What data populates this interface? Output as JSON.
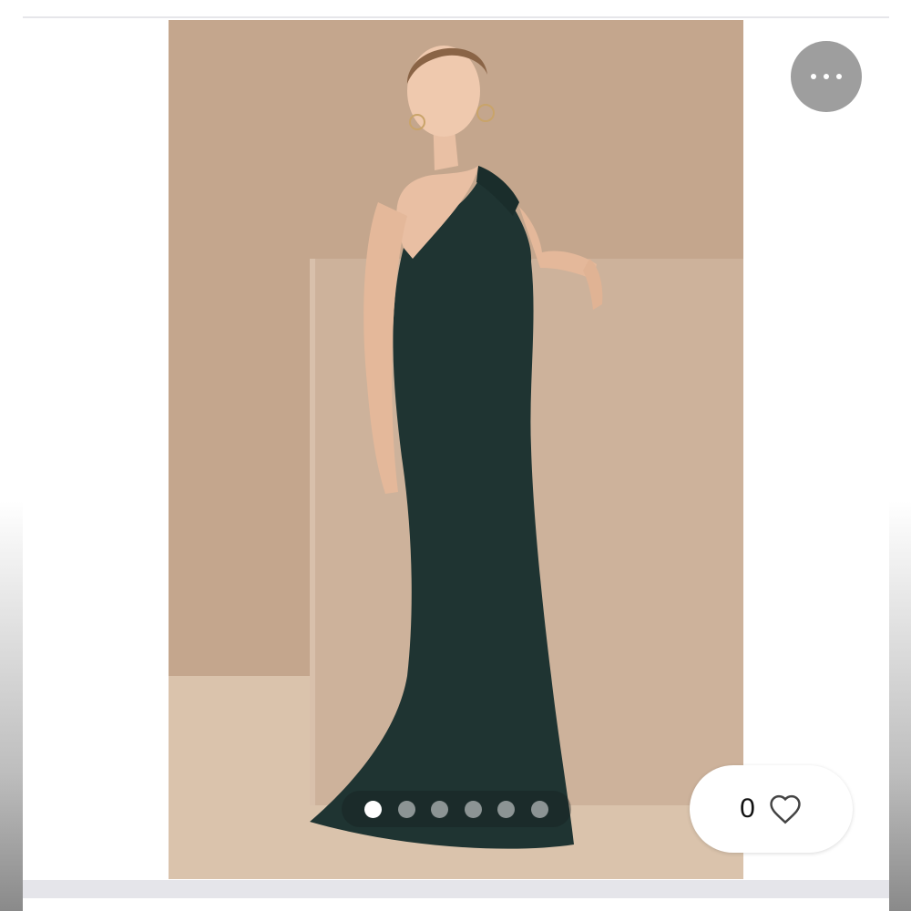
{
  "listing": {
    "like_count": "0",
    "image_count": 6,
    "current_image_index": 0
  },
  "icons": {
    "more": "more-horizontal-icon",
    "like": "heart-outline-icon"
  },
  "colors": {
    "dress": "#1f3432",
    "backdrop": "#c6a890",
    "pager_active": "#ffffff",
    "pager_inactive": "#8c9494"
  }
}
